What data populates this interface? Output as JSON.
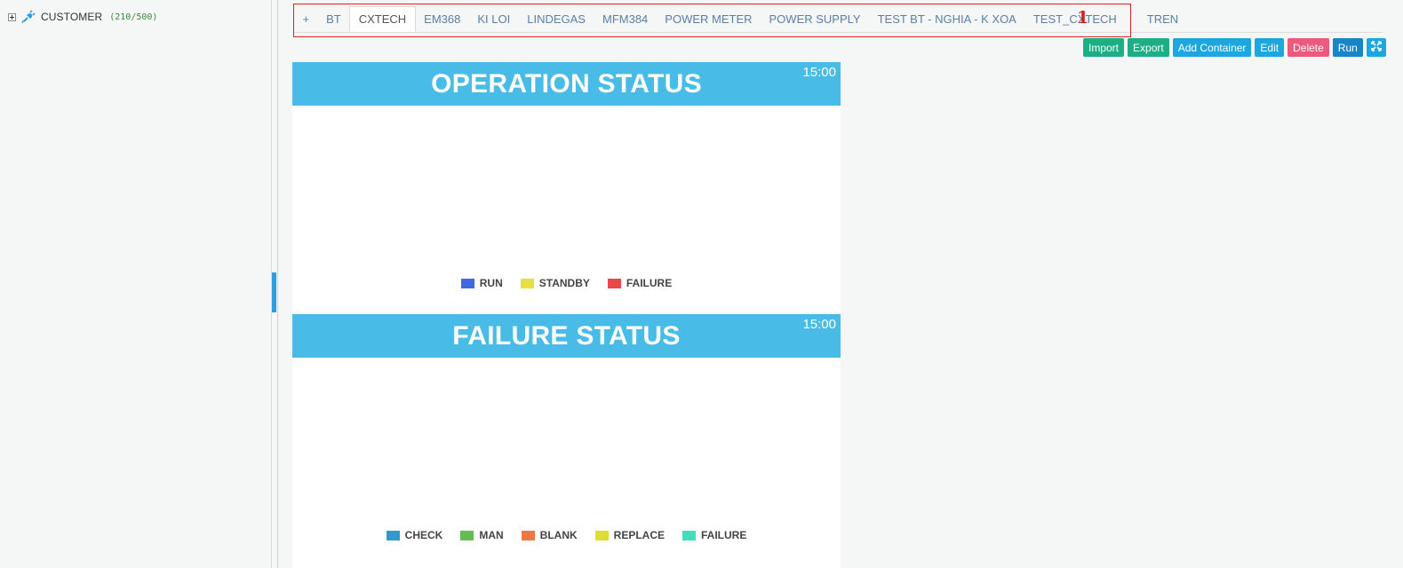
{
  "sidebar": {
    "tree": [
      {
        "label": "CUSTOMER",
        "count": "(210/500)",
        "icon": "plug-icon",
        "expanded": false
      }
    ]
  },
  "tabs": [
    {
      "label": "+"
    },
    {
      "label": "BT"
    },
    {
      "label": "CXTECH",
      "active": true
    },
    {
      "label": "EM368"
    },
    {
      "label": "KI LOI"
    },
    {
      "label": "LINDEGAS"
    },
    {
      "label": "MFM384"
    },
    {
      "label": "POWER METER"
    },
    {
      "label": "POWER SUPPLY"
    },
    {
      "label": "TEST BT - NGHIA - K XOA"
    },
    {
      "label": "TEST_CXTECH"
    },
    {
      "label": "TREN"
    }
  ],
  "annotation_marker": "1",
  "toolbar": {
    "import_label": "Import",
    "export_label": "Export",
    "add_container_label": "Add Container",
    "edit_label": "Edit",
    "delete_label": "Delete",
    "run_label": "Run",
    "fullscreen_icon": "expand-icon"
  },
  "panels": [
    {
      "title": "OPERATION STATUS",
      "time": "15:00",
      "legend": [
        {
          "label": "RUN",
          "color": "#4169e1"
        },
        {
          "label": "STANDBY",
          "color": "#e8e040"
        },
        {
          "label": "FAILURE",
          "color": "#e84848"
        }
      ]
    },
    {
      "title": "FAILURE STATUS",
      "time": "15:00",
      "legend": [
        {
          "label": "CHECK",
          "color": "#3399cc"
        },
        {
          "label": "MAN",
          "color": "#66bb55"
        },
        {
          "label": "BLANK",
          "color": "#ee7744"
        },
        {
          "label": "REPLACE",
          "color": "#dddd33"
        },
        {
          "label": "FAILURE",
          "color": "#44ddbb"
        }
      ]
    }
  ],
  "colors": {
    "header_bg": "#48bce6",
    "tab_text": "#5a7fa8",
    "annotation": "#e02020"
  }
}
